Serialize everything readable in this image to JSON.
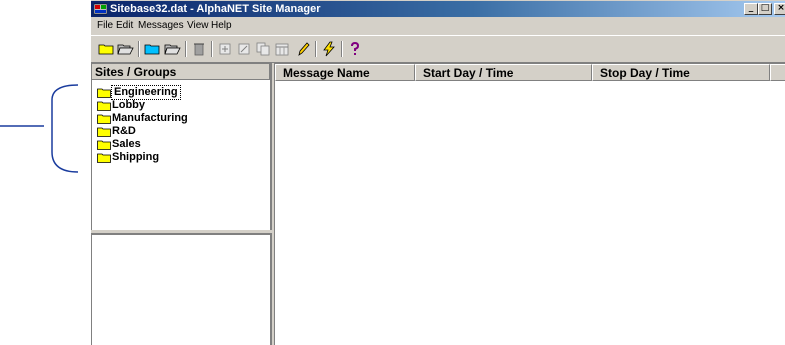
{
  "window": {
    "title": "Sitebase32.dat - AlphaNET Site Manager",
    "minimize_glyph": "_",
    "maximize_glyph": "□",
    "close_glyph": "×"
  },
  "menu": [
    "File",
    "Edit",
    "Messages",
    "View",
    "Help"
  ],
  "toolbar": {
    "icons": [
      "new-folder-icon",
      "open-folder-icon",
      "new-folder-icon",
      "open-folder-icon",
      "trash-icon",
      "add-message-icon",
      "edit-message-icon",
      "copy-message-icon",
      "schedule-icon",
      "pencil-icon",
      "lightning-icon",
      "help-icon"
    ]
  },
  "sites_panel": {
    "header": "Sites / Groups",
    "items": [
      "Engineering",
      "Lobby",
      "Manufacturing",
      "R&D",
      "Sales",
      "Shipping"
    ],
    "selected": "Engineering"
  },
  "message_list": {
    "columns": [
      "Message Name",
      "Start Day / Time",
      "Stop Day / Time"
    ]
  },
  "colors": {
    "annotation": "#1a3c9e",
    "folder": "#ffff00",
    "titlebar_start": "#0a246a",
    "titlebar_end": "#a6caf0",
    "chrome": "#d4d0c8"
  }
}
